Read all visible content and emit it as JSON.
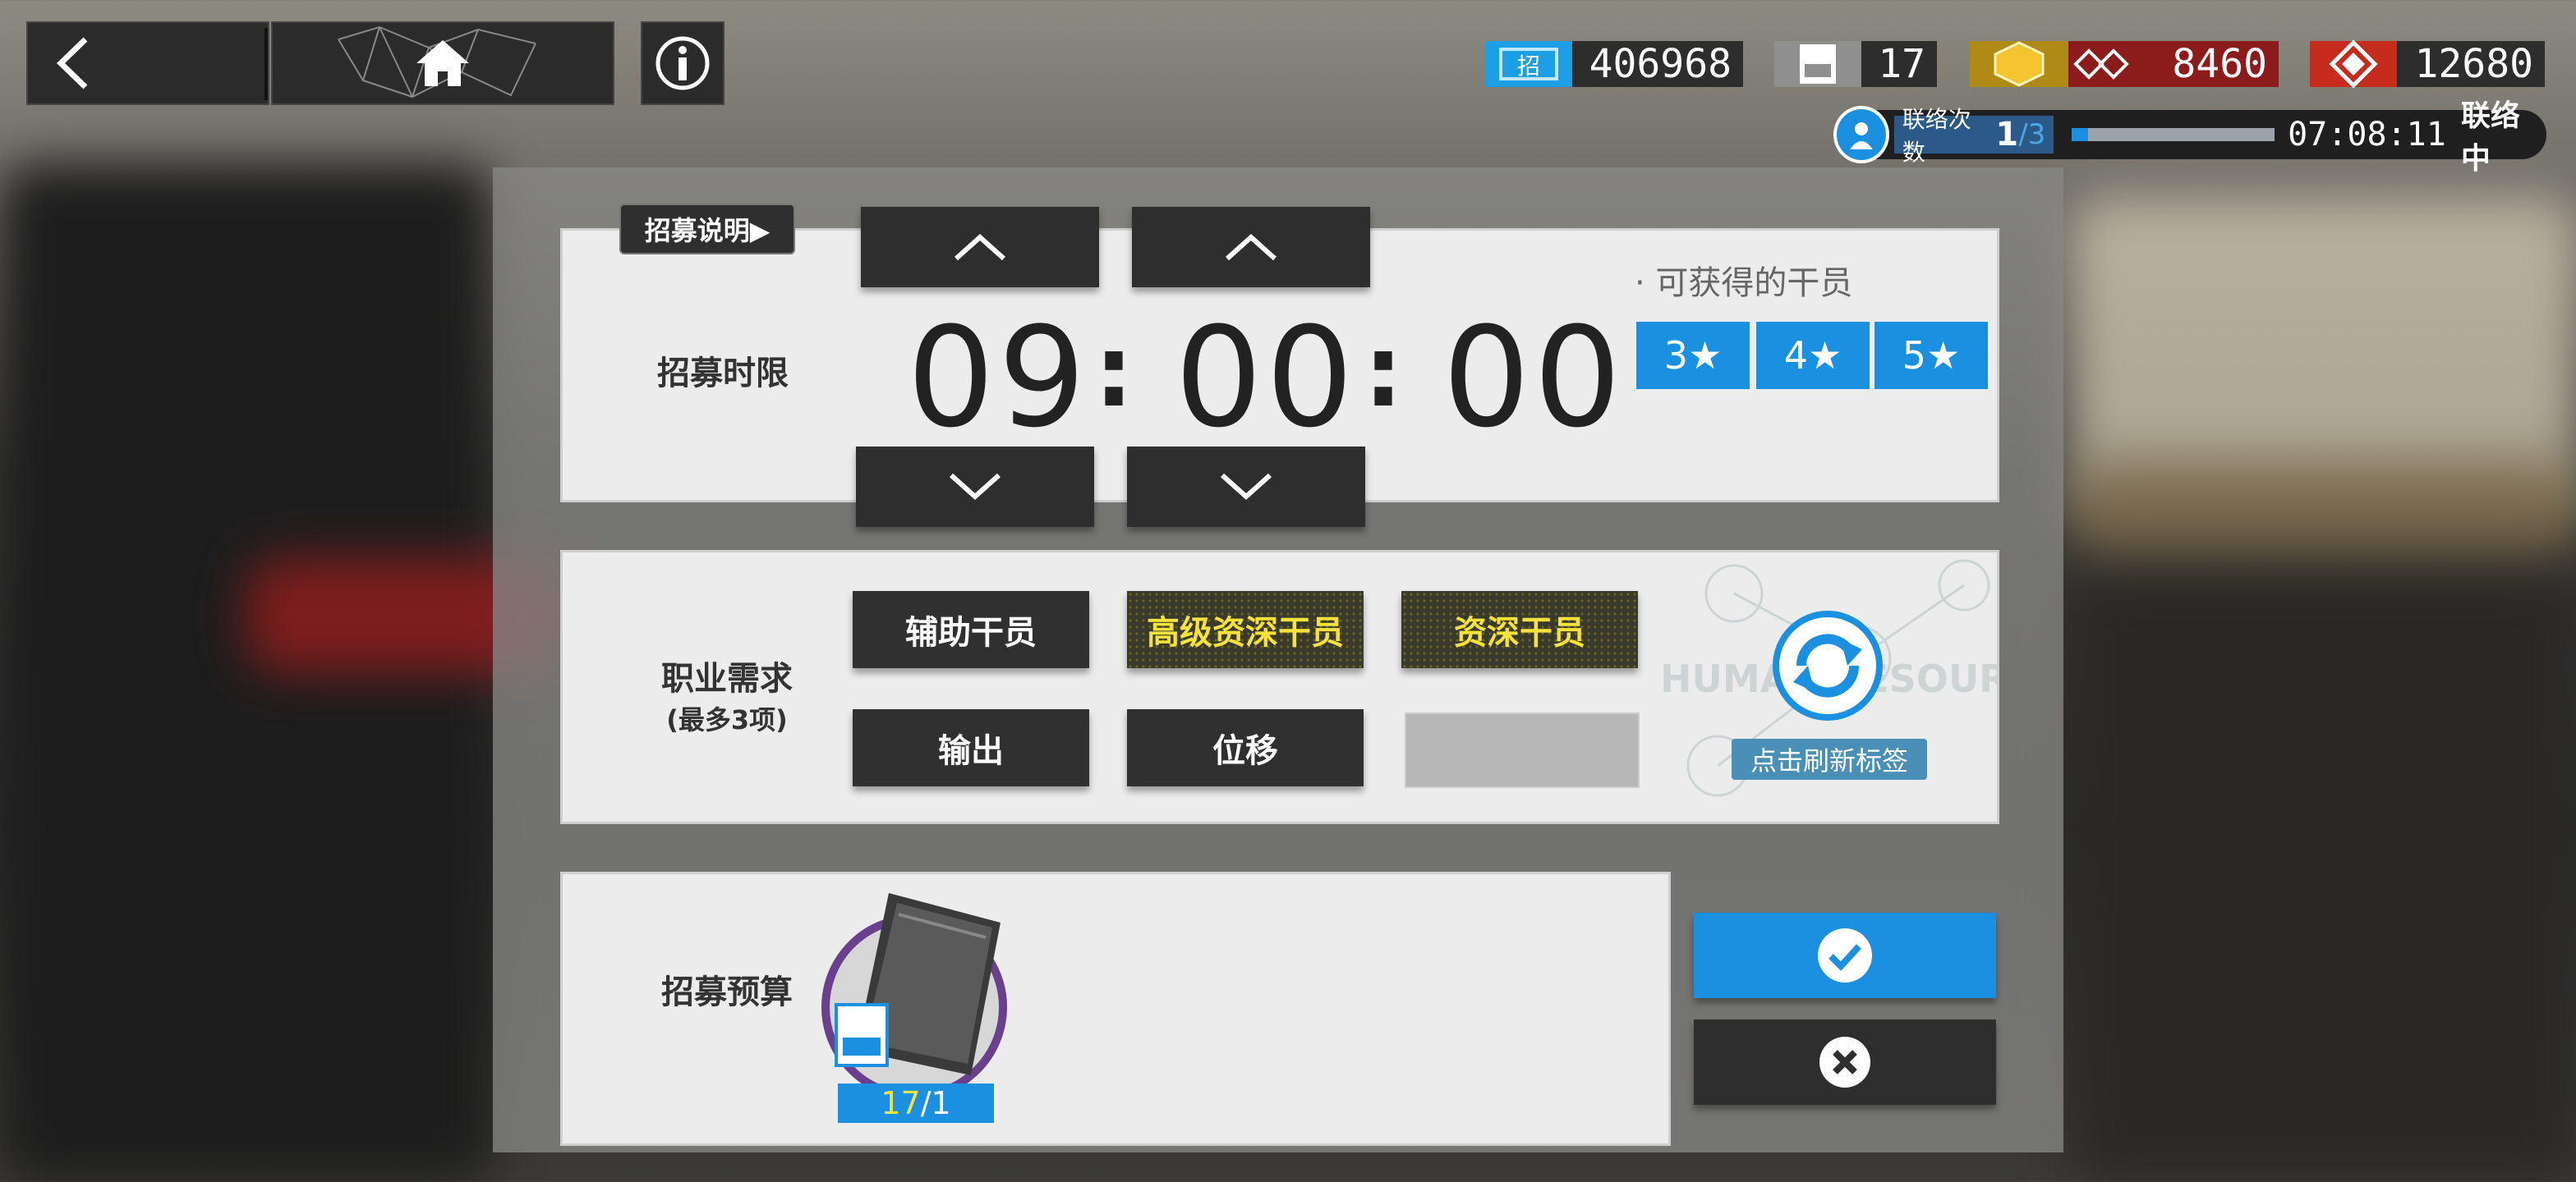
{
  "topbar": {
    "back_icon": "chevron-left-icon",
    "home_icon": "home-icon",
    "info_icon": "info-icon"
  },
  "resources": [
    {
      "name": "recruit-permit",
      "icon": "ticket-icon",
      "value": "406968",
      "color": "#1d9fe6"
    },
    {
      "name": "hire-permit",
      "icon": "permit-icon",
      "value": "17",
      "color": "#9e9e9e"
    },
    {
      "name": "originite",
      "icon": "diamond-icon",
      "value": "8460",
      "color": "#8c1b1b"
    },
    {
      "name": "orundum",
      "icon": "gem-icon",
      "value": "12680",
      "color": "#c62b1d"
    }
  ],
  "contact": {
    "label": "联络次数",
    "count": "1",
    "total": "/3",
    "progress": 0.08,
    "timer": "07:08:11",
    "status": "联络中"
  },
  "time_section": {
    "help_label": "招募说明▶",
    "title": "招募时限",
    "hours": "09",
    "minutes": "00",
    "seconds": "00",
    "colon": ":",
    "obtainable_title": "· 可获得的干员",
    "stars": [
      "3★",
      "4★",
      "5★"
    ]
  },
  "tags_section": {
    "title": "职业需求",
    "subtitle": "(最多3项)",
    "tags": [
      {
        "label": "辅助干员",
        "gold": false
      },
      {
        "label": "高级资深干员",
        "gold": true
      },
      {
        "label": "资深干员",
        "gold": true
      },
      {
        "label": "输出",
        "gold": false
      },
      {
        "label": "位移",
        "gold": false
      }
    ],
    "refresh_label": "点击刷新标签",
    "watermark": "HUMAN RESOURCES"
  },
  "budget_section": {
    "title": "招募预算",
    "permit_count": "17",
    "permit_cost": "/1"
  },
  "actions": {
    "confirm_icon": "check-icon",
    "cancel_icon": "close-icon"
  },
  "colors": {
    "accent": "#1b8fe0",
    "gold": "#f6e23a",
    "dark": "#2e2e2e"
  }
}
